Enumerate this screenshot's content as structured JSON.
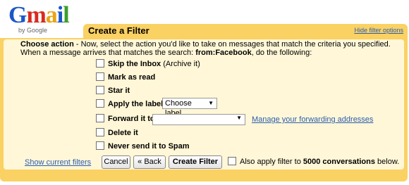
{
  "logo": {
    "word": [
      "G",
      "m",
      "a",
      "i",
      "l"
    ],
    "by": "by Google"
  },
  "header": {
    "title": "Create a Filter",
    "hide_link": "Hide filter options"
  },
  "intro": {
    "line1_bold": "Choose action",
    "line1_rest": " - Now, select the action you'd like to take on messages that match the criteria you specified.",
    "line2_prefix": "When a message arrives that matches the search: ",
    "line2_query": "from:Facebook",
    "line2_suffix": ", do the following:"
  },
  "actions": {
    "skip_inbox": "Skip the Inbox",
    "skip_inbox_note": "(Archive it)",
    "mark_read": "Mark as read",
    "star": "Star it",
    "apply_label": "Apply the label:",
    "label_select": "Choose label...",
    "forward": "Forward it to:",
    "forward_value": "",
    "manage_forwarding": "Manage your forwarding addresses",
    "delete": "Delete it",
    "never_spam": "Never send it to Spam"
  },
  "footer": {
    "show_filters": "Show current filters",
    "cancel": "Cancel",
    "back": "« Back",
    "create": "Create Filter",
    "also_prefix": "Also apply filter to ",
    "also_count": "5000 conversations",
    "also_suffix": " below."
  },
  "colors": {
    "frame": "#fad163",
    "panel": "#fff7d7",
    "link": "#2a5db0"
  }
}
